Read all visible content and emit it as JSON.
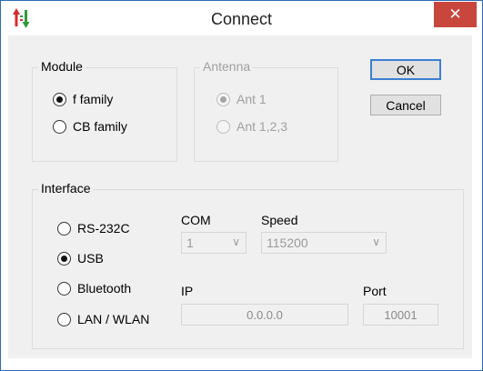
{
  "window": {
    "title": "Connect",
    "close_glyph": "✕"
  },
  "icons": {
    "app": "sort-arrows-icon",
    "close": "close-icon"
  },
  "module": {
    "title": "Module",
    "options": [
      {
        "label": "f family",
        "checked": true
      },
      {
        "label": "CB family",
        "checked": false
      }
    ]
  },
  "antenna": {
    "title": "Antenna",
    "options": [
      {
        "label": "Ant 1",
        "checked": true
      },
      {
        "label": "Ant 1,2,3",
        "checked": false
      }
    ]
  },
  "buttons": {
    "ok": "OK",
    "cancel": "Cancel"
  },
  "interface": {
    "title": "Interface",
    "options": [
      {
        "label": "RS-232C",
        "checked": false
      },
      {
        "label": "USB",
        "checked": true
      },
      {
        "label": "Bluetooth",
        "checked": false
      },
      {
        "label": "LAN / WLAN",
        "checked": false
      }
    ],
    "com_label": "COM",
    "com_value": "1",
    "speed_label": "Speed",
    "speed_value": "115200",
    "ip_label": "IP",
    "ip_value": "0.0.0.0",
    "port_label": "Port",
    "port_value": "10001",
    "dropdown_glyph": "∨"
  },
  "colors": {
    "close_bg": "#c9463d",
    "window_border": "#2b6bb4",
    "accent": "#3c7fd2"
  }
}
